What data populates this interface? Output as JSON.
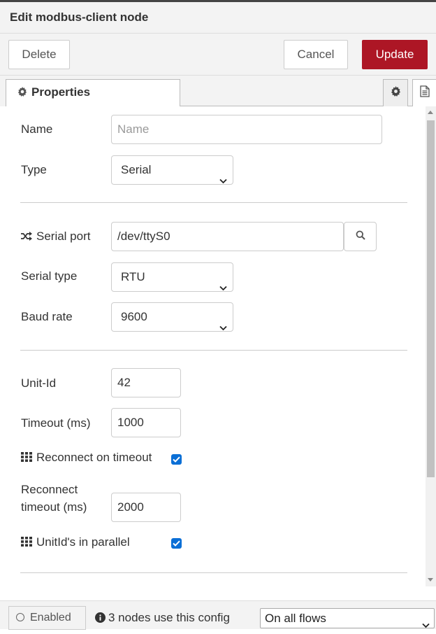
{
  "dialog": {
    "title": "Edit modbus-client node"
  },
  "toolbar": {
    "delete_label": "Delete",
    "cancel_label": "Cancel",
    "update_label": "Update",
    "update_color": "#ad1625"
  },
  "tabs": {
    "properties_label": "Properties",
    "icons": [
      "gear-icon",
      "document-icon"
    ]
  },
  "form": {
    "name": {
      "label": "Name",
      "placeholder": "Name",
      "value": ""
    },
    "type": {
      "label": "Type",
      "selected": "Serial"
    },
    "serial_port": {
      "label": "Serial port",
      "value": "/dev/ttyS0",
      "icon": "shuffle-icon"
    },
    "serial_type": {
      "label": "Serial type",
      "selected": "RTU"
    },
    "baud_rate": {
      "label": "Baud rate",
      "selected": "9600"
    },
    "unit_id": {
      "label": "Unit-Id",
      "value": "42"
    },
    "timeout": {
      "label": "Timeout (ms)",
      "value": "1000"
    },
    "reconnect_on_timeout": {
      "label": "Reconnect on timeout",
      "checked": true,
      "icon": "grid-icon"
    },
    "reconnect_timeout": {
      "label_line1": "Reconnect",
      "label_line2": "timeout (ms)",
      "value": "2000"
    },
    "unitids_parallel": {
      "label": "UnitId's in parallel",
      "checked": true,
      "icon": "grid-icon"
    }
  },
  "footer": {
    "enabled_label": "Enabled",
    "users_text": "3 nodes use this config",
    "scope_selected": "On all flows"
  },
  "colors": {
    "checkbox": "#0b6fd6",
    "accent": "#ad1625"
  }
}
